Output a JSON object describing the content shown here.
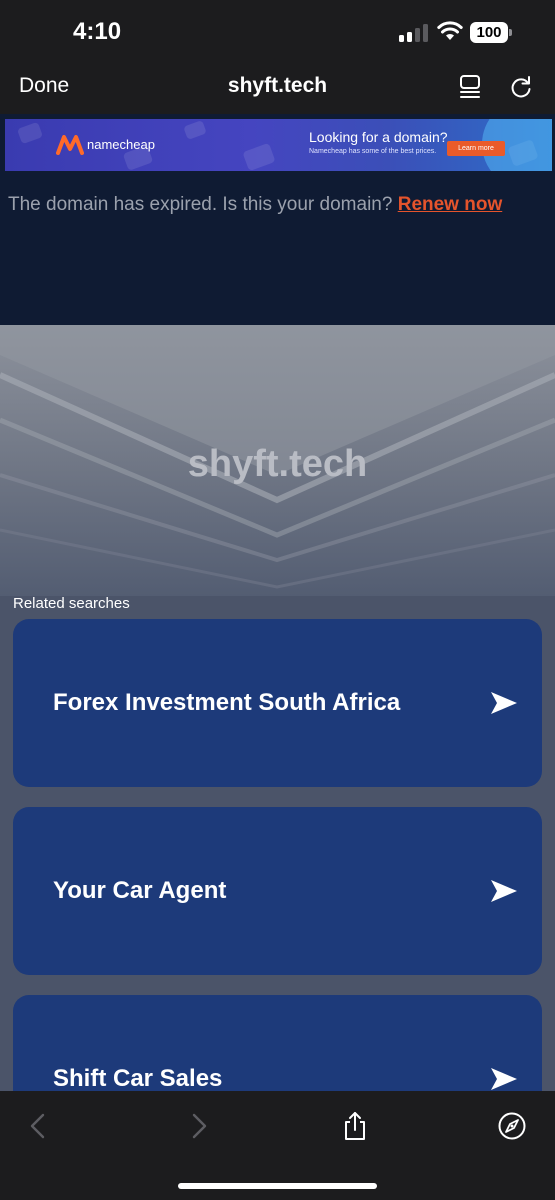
{
  "status_bar": {
    "time": "4:10",
    "battery": "100"
  },
  "nav": {
    "done_label": "Done",
    "title": "shyft.tech",
    "reader_icon": "reader-mode-icon",
    "reload_icon": "reload-icon"
  },
  "ad": {
    "brand": "namecheap",
    "headline": "Looking for a domain?",
    "subtext": "Namecheap has some of the best prices.",
    "cta": "Learn more",
    "accent": "#ea5b2a"
  },
  "notice": {
    "text": "The domain has expired. Is this your domain?",
    "link": "Renew now",
    "link_color": "#e5542c"
  },
  "hero": {
    "title": "shyft.tech"
  },
  "related": {
    "label": "Related searches",
    "items": [
      {
        "label": "Forex Investment South Africa"
      },
      {
        "label": "Your Car Agent"
      },
      {
        "label": "Shift Car Sales"
      }
    ]
  },
  "toolbar": {
    "icons": [
      "back-icon",
      "forward-icon",
      "share-icon",
      "safari-compass-icon"
    ]
  },
  "colors": {
    "card": "#1d3a7a",
    "page_bg": "#4b5469",
    "top_dark": "#0f1b33"
  }
}
